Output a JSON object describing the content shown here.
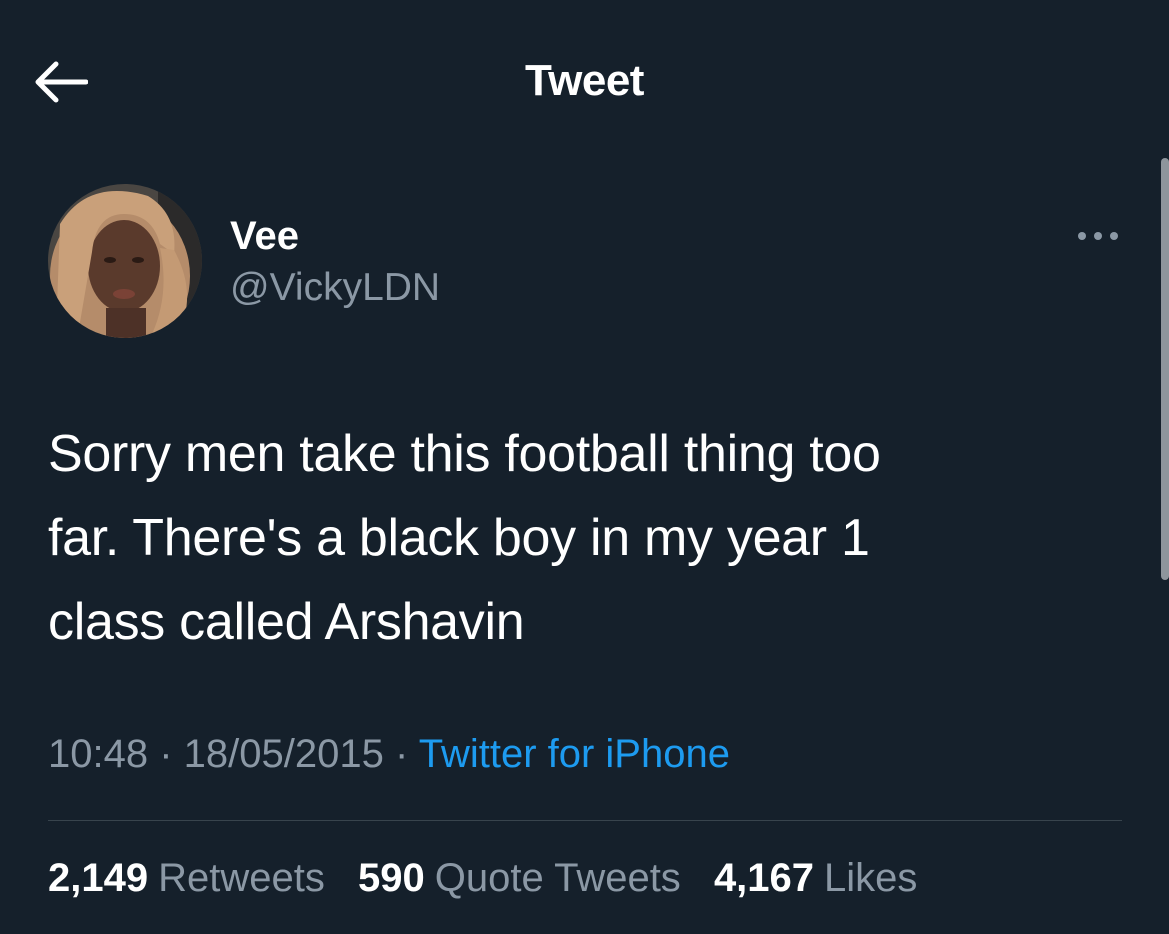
{
  "colors": {
    "background": "#15202b",
    "primary_text": "#ffffff",
    "secondary_text": "#8b98a5",
    "link": "#1d9bf0",
    "divider": "#38444d"
  },
  "header": {
    "back_icon": "arrow-left-icon",
    "title": "Tweet"
  },
  "author": {
    "display_name": "Vee",
    "handle": "@VickyLDN",
    "more_icon": "more-horizontal-icon"
  },
  "tweet": {
    "lines": [
      "Sorry men take this football thing too",
      "far. There's a black boy in my year 1",
      "class called Arshavin"
    ]
  },
  "meta": {
    "time": "10:48",
    "separator": "·",
    "date": "18/05/2015",
    "source": "Twitter for iPhone"
  },
  "stats": {
    "retweets_count": "2,149",
    "retweets_label": "Retweets",
    "quotes_count": "590",
    "quotes_label": "Quote Tweets",
    "likes_count": "4,167",
    "likes_label": "Likes"
  }
}
